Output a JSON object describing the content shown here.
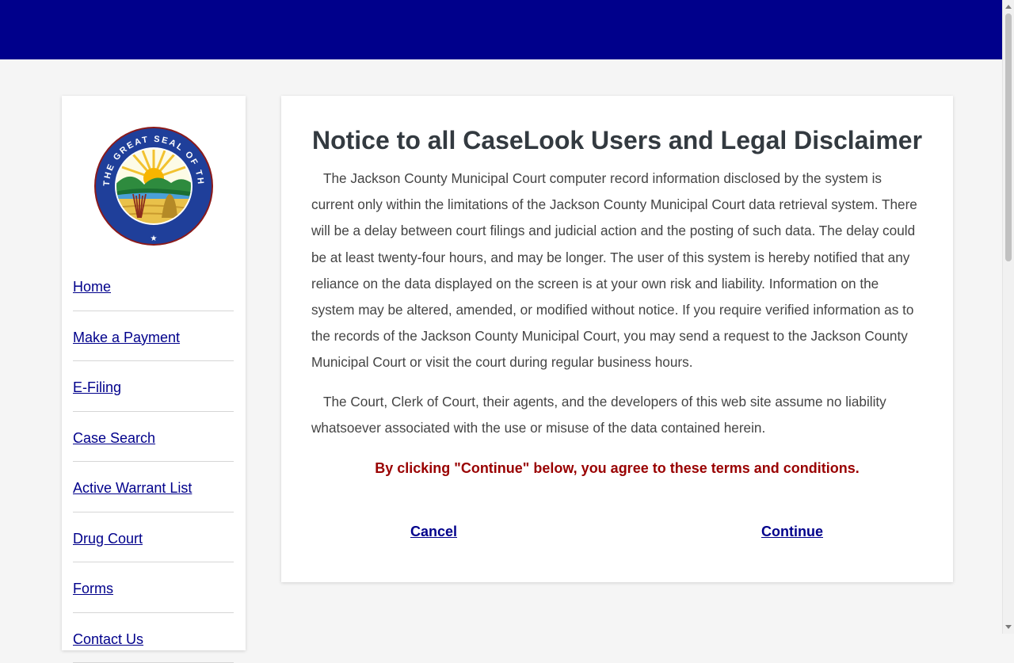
{
  "colors": {
    "header": "#00008b",
    "link": "#00008b",
    "agree_text": "#990000",
    "heading": "#333a40"
  },
  "logo": {
    "alt": "The Great Seal of the State of Ohio",
    "ring_text": "THE GREAT SEAL OF THE STATE OF OHIO"
  },
  "nav": {
    "items": [
      {
        "label": "Home"
      },
      {
        "label": "Make a Payment"
      },
      {
        "label": "E-Filing"
      },
      {
        "label": "Case Search"
      },
      {
        "label": "Active Warrant List"
      },
      {
        "label": "Drug Court"
      },
      {
        "label": "Forms"
      },
      {
        "label": "Contact Us"
      }
    ]
  },
  "notice": {
    "title": "Notice to all CaseLook Users and Legal Disclaimer",
    "paragraph1": "The Jackson County Municipal Court computer record information disclosed by the system is current only within the limitations of the Jackson County Municipal Court data retrieval system. There will be a delay between court filings and judicial action and the posting of such data. The delay could be at least twenty-four hours, and may be longer. The user of this system is hereby notified that any reliance on the data displayed on the screen is at your own risk and liability. Information on the system may be altered, amended, or modified without notice. If you require verified information as to the records of the Jackson County Municipal Court, you may send a request to the Jackson County Municipal Court or visit the court during regular business hours.",
    "paragraph2": "The Court, Clerk of Court, their agents, and the developers of this web site assume no liability whatsoever associated with the use or misuse of the data contained herein.",
    "agree_text": "By clicking \"Continue\" below, you agree to these terms and conditions.",
    "cancel_label": "Cancel",
    "continue_label": "Continue"
  }
}
